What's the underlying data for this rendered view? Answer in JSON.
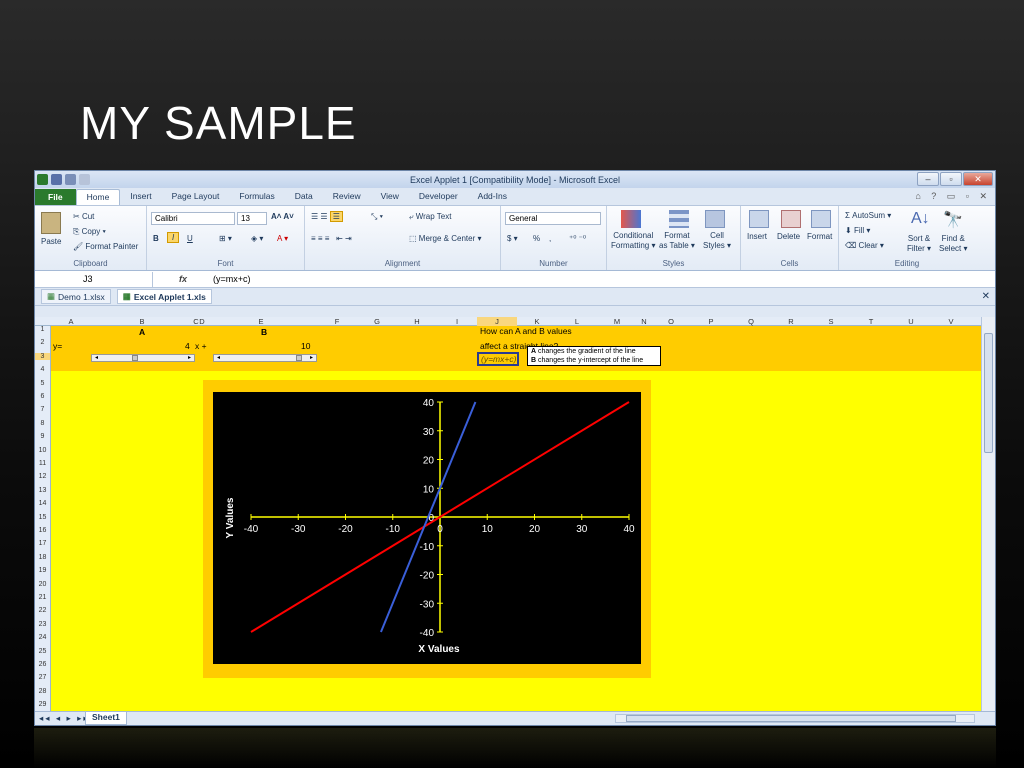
{
  "slide": {
    "title": "MY SAMPLE"
  },
  "window": {
    "title": "Excel Applet 1  [Compatibility Mode]  -  Microsoft Excel"
  },
  "ribbon_tabs": [
    "File",
    "Home",
    "Insert",
    "Page Layout",
    "Formulas",
    "Data",
    "Review",
    "View",
    "Developer",
    "Add-Ins"
  ],
  "clipboard": {
    "paste": "Paste",
    "cut": "Cut",
    "copy": "Copy",
    "format_painter": "Format Painter",
    "label": "Clipboard"
  },
  "font": {
    "name": "Calibri",
    "size": "13",
    "bold": "B",
    "italic": "I",
    "underline": "U",
    "label": "Font"
  },
  "alignment": {
    "wrap_text": "Wrap Text",
    "merge_center": "Merge & Center",
    "label": "Alignment"
  },
  "number": {
    "format": "General",
    "currency": "$",
    "percent": "%",
    "comma": ",",
    "label": "Number"
  },
  "styles": {
    "conditional": "Conditional",
    "conditional2": "Formatting",
    "format_table": "Format",
    "format_table2": "as Table",
    "cell_styles": "Cell",
    "cell_styles2": "Styles",
    "label": "Styles"
  },
  "cells": {
    "insert": "Insert",
    "delete": "Delete",
    "format": "Format",
    "label": "Cells"
  },
  "editing": {
    "autosum": "AutoSum",
    "fill": "Fill",
    "clear": "Clear",
    "sort": "Sort &",
    "sort2": "Filter",
    "find": "Find &",
    "find2": "Select",
    "label": "Editing"
  },
  "formula_bar": {
    "name_box": "J3",
    "fx": "fx",
    "formula": "(y=mx+c)"
  },
  "documents": [
    "Demo 1.xlsx",
    "Excel Applet 1.xls"
  ],
  "columns": [
    "A",
    "B",
    "C",
    "D",
    "E",
    "F",
    "G",
    "H",
    "I",
    "J",
    "K",
    "L",
    "M",
    "N",
    "O",
    "P",
    "Q",
    "R",
    "S",
    "T",
    "U",
    "V"
  ],
  "rows": [
    "1",
    "2",
    "3",
    "4",
    "5",
    "6",
    "7",
    "8",
    "9",
    "10",
    "11",
    "12",
    "13",
    "14",
    "15",
    "16",
    "17",
    "18",
    "19",
    "20",
    "21",
    "22",
    "23",
    "24",
    "25",
    "26",
    "27",
    "28",
    "29"
  ],
  "sheet": {
    "label_a": "A",
    "label_b": "B",
    "y_eq": "y=",
    "a_value": "4",
    "x_plus": "x +",
    "b_value": "10",
    "question1": "How can A and B values",
    "question2": "affect a straight line?",
    "formula_cell": "(y=mx+c)",
    "note_a_key": "A",
    "note_a_text": "changes the gradient of the line",
    "note_b_key": "B",
    "note_b_text": "changes the y-intercept of the line"
  },
  "sheet_tabs": [
    "Sheet1"
  ],
  "chart_data": {
    "type": "line",
    "xlabel": "X Values",
    "ylabel": "Y Values",
    "xlim": [
      -40,
      40
    ],
    "ylim": [
      -40,
      40
    ],
    "xticks": [
      -40,
      -30,
      -20,
      -10,
      0,
      10,
      20,
      30,
      40
    ],
    "yticks": [
      -40,
      -30,
      -20,
      -10,
      0,
      10,
      20,
      30,
      40
    ],
    "series": [
      {
        "color": "#ff0000",
        "x": [
          -40,
          40
        ],
        "y": [
          -40,
          40
        ]
      },
      {
        "color": "#3a5fd9",
        "x": [
          -12.5,
          7.5
        ],
        "y": [
          -40,
          40
        ]
      }
    ],
    "background": "#000000",
    "axis_color": "#ffff00"
  }
}
